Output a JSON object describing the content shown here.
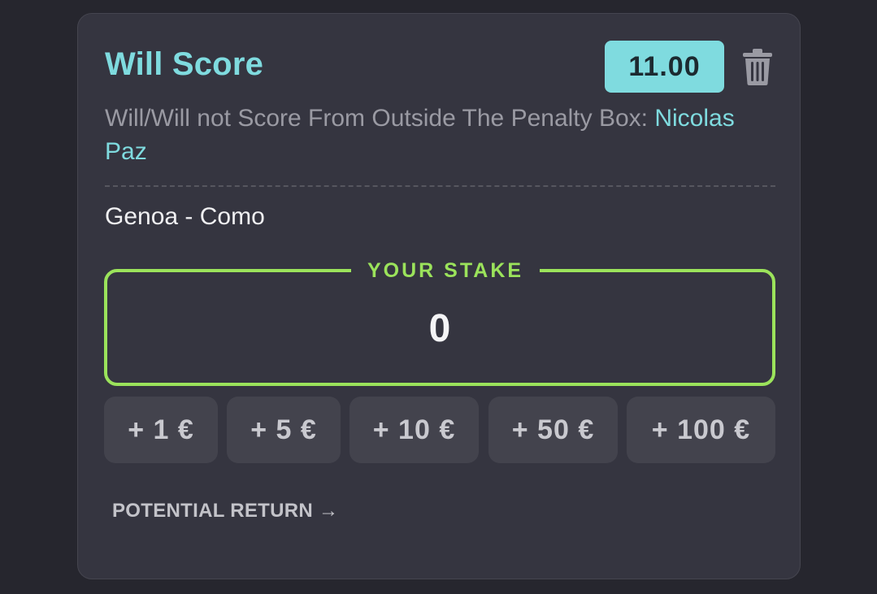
{
  "bet": {
    "title": "Will Score",
    "odds": "11.00",
    "market_label": "Will/Will not Score From Outside The Penalty Box: ",
    "player": "Nicolas Paz",
    "match": "Genoa - Como"
  },
  "stake": {
    "label": "YOUR STAKE",
    "value": "0"
  },
  "quick_stakes": [
    {
      "label": "+ 1 €"
    },
    {
      "label": "+ 5 €"
    },
    {
      "label": "+ 10 €"
    },
    {
      "label": "+ 50 €"
    },
    {
      "label": "+ 100 €"
    }
  ],
  "potential_return": {
    "label": "POTENTIAL RETURN →"
  },
  "colors": {
    "accent": "#7fdbdf",
    "stake_border": "#9be35b",
    "card_bg": "#353540",
    "page_bg": "#26262e"
  },
  "icons": {
    "delete": "trash-icon"
  }
}
